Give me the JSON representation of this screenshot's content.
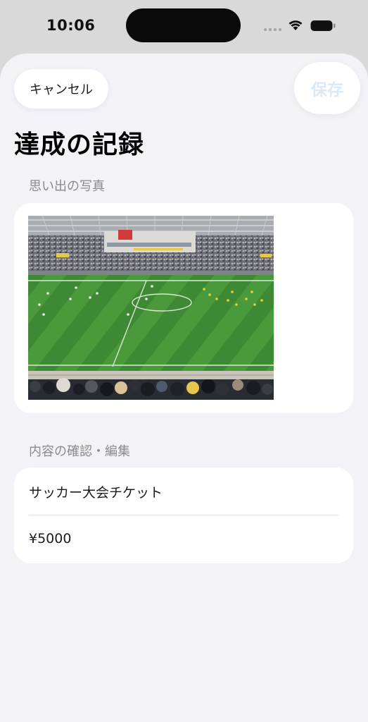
{
  "status_bar": {
    "time": "10:06",
    "wifi_icon": "wifi-icon",
    "battery_icon": "battery-icon"
  },
  "nav": {
    "cancel_label": "キャンセル",
    "save_label": "保存"
  },
  "page": {
    "title": "達成の記録"
  },
  "photo_section": {
    "header": "思い出の写真",
    "image": "soccer-stadium-photo"
  },
  "content_section": {
    "header": "内容の確認・編集",
    "fields": [
      {
        "value": "サッカー大会チケット"
      },
      {
        "value": "¥5000"
      }
    ]
  },
  "colors": {
    "background": "#f2f2f7",
    "card": "#ffffff",
    "section_header": "#8a8a8e",
    "save_disabled": "#dbe9f5"
  }
}
